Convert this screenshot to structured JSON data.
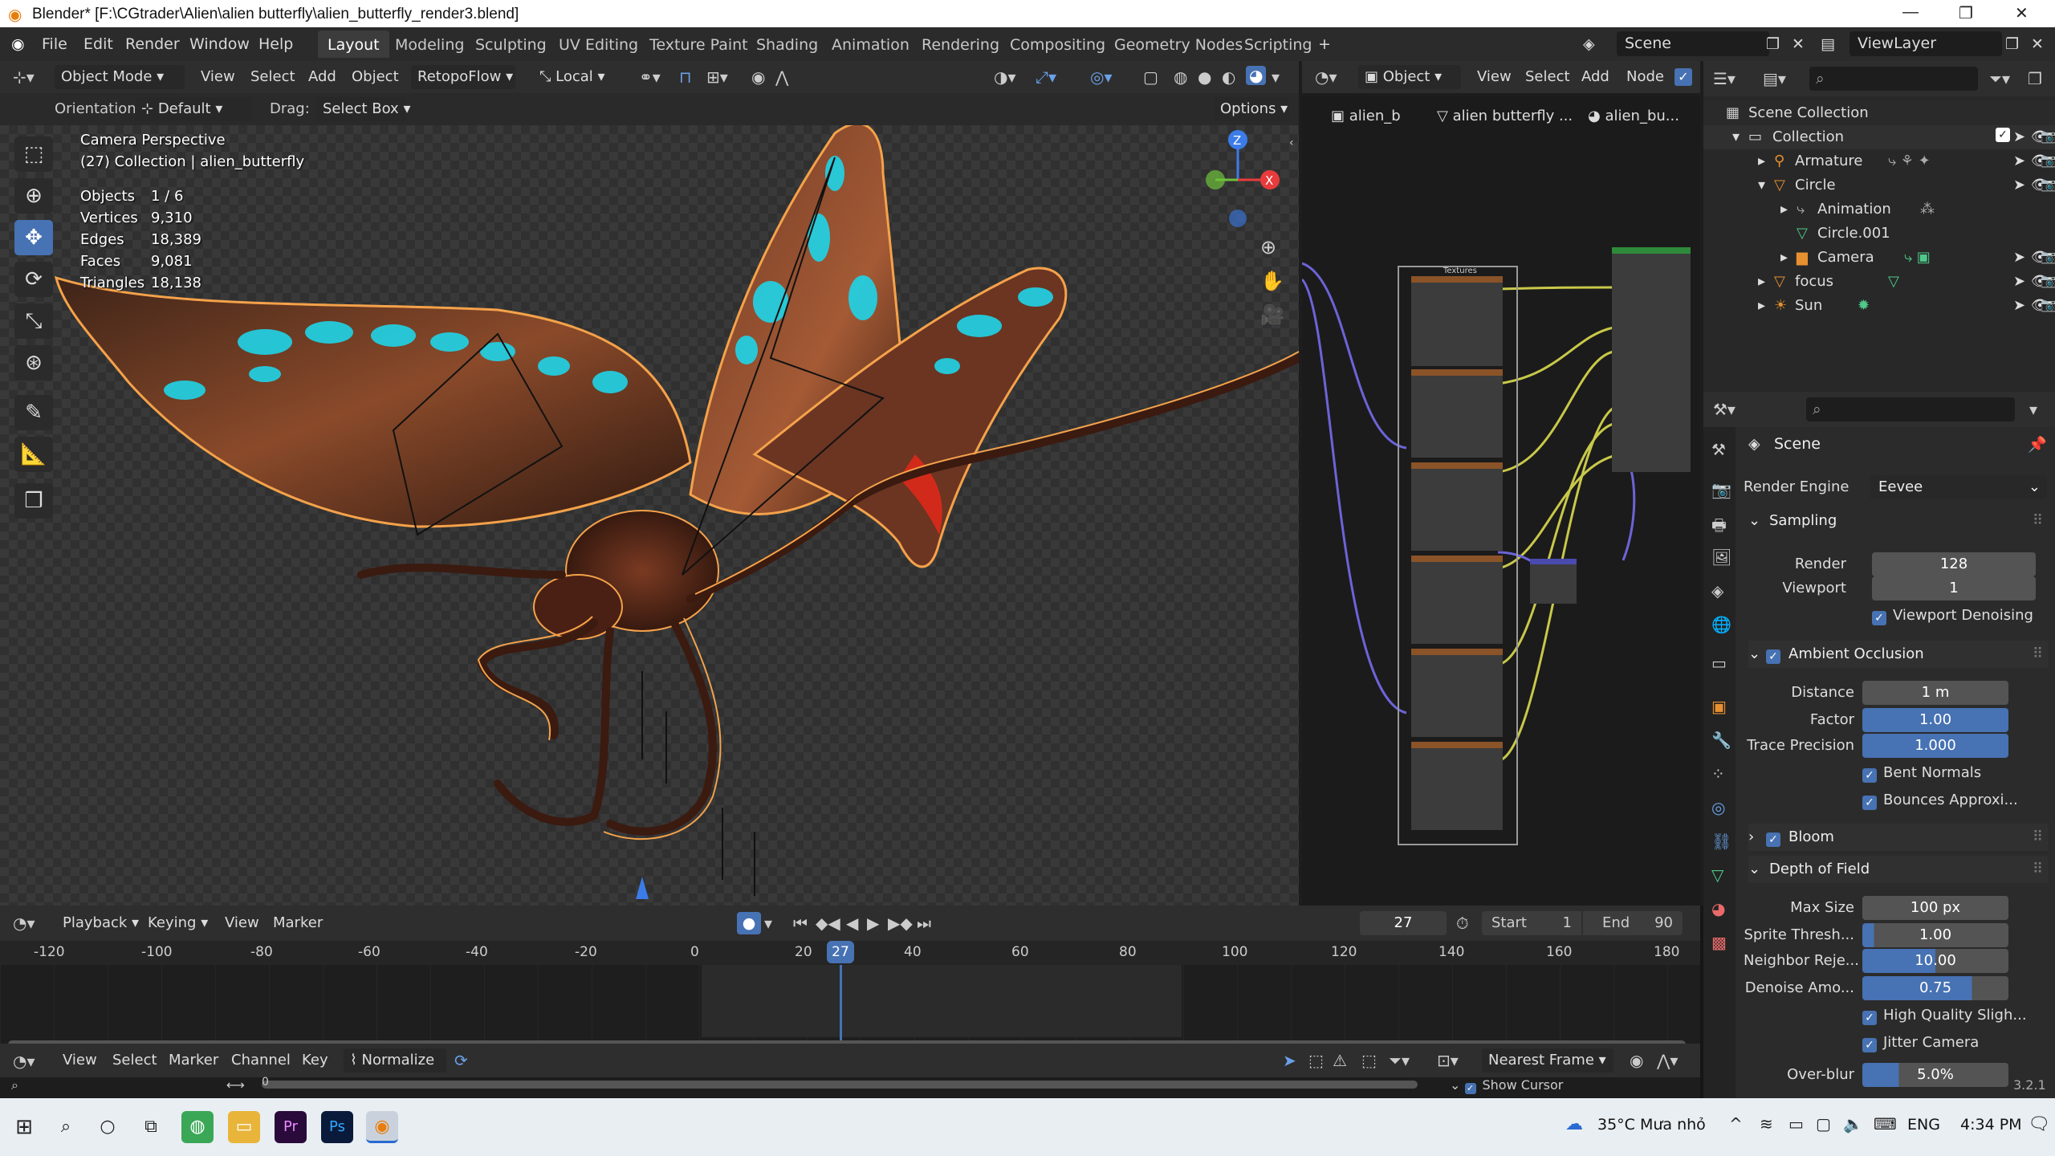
{
  "window": {
    "title": "Blender* [F:\\CGtrader\\Alien\\alien butterfly\\alien_butterfly_render3.blend]"
  },
  "menu": {
    "items": [
      "File",
      "Edit",
      "Render",
      "Window",
      "Help"
    ]
  },
  "workspaces": [
    "Layout",
    "Modeling",
    "Sculpting",
    "UV Editing",
    "Texture Paint",
    "Shading",
    "Animation",
    "Rendering",
    "Compositing",
    "Geometry Nodes",
    "Scripting"
  ],
  "scene_field": "Scene",
  "viewlayer_field": "ViewLayer",
  "viewport_header": {
    "mode": "Object Mode",
    "view": "View",
    "select": "Select",
    "add": "Add",
    "object": "Object",
    "addon": "RetopoFlow",
    "transform": "Local",
    "orientation_label": "Orientation:",
    "orientation_value": "Default",
    "drag_label": "Drag:",
    "drag_value": "Select Box",
    "options": "Options"
  },
  "viewport_overlay": {
    "perspective": "Camera Perspective",
    "collection": "(27) Collection | alien_butterfly",
    "stats": [
      {
        "label": "Objects",
        "value": "1 / 6"
      },
      {
        "label": "Vertices",
        "value": "9,310"
      },
      {
        "label": "Edges",
        "value": "18,389"
      },
      {
        "label": "Faces",
        "value": "9,081"
      },
      {
        "label": "Triangles",
        "value": "18,138"
      }
    ],
    "gizmo": {
      "z": "Z",
      "x": "X"
    }
  },
  "node_header": {
    "object": "Object",
    "view": "View",
    "select": "Select",
    "add": "Add",
    "node": "Node",
    "breadcrumbs": [
      "alien_b",
      "alien butterfly ...",
      "alien_bu..."
    ],
    "frame_label": "Textures"
  },
  "outliner": {
    "rows": [
      {
        "label": "Scene Collection",
        "indent": 0,
        "icon": "scene-collection-icon"
      },
      {
        "label": "Collection",
        "indent": 1,
        "icon": "collection-icon"
      },
      {
        "label": "Armature",
        "indent": 2,
        "icon": "armature-icon"
      },
      {
        "label": "Circle",
        "indent": 2,
        "icon": "object-icon"
      },
      {
        "label": "Animation",
        "indent": 3,
        "icon": "animation-icon"
      },
      {
        "label": "Circle.001",
        "indent": 3,
        "icon": "mesh-icon"
      },
      {
        "label": "Camera",
        "indent": 3,
        "icon": "camera-icon"
      },
      {
        "label": "focus",
        "indent": 2,
        "icon": "empty-icon"
      },
      {
        "label": "Sun",
        "indent": 2,
        "icon": "light-icon"
      }
    ]
  },
  "properties": {
    "context": "Scene",
    "render_engine_label": "Render Engine",
    "render_engine_value": "Eevee",
    "sampling": {
      "title": "Sampling",
      "render_label": "Render",
      "render_value": "128",
      "viewport_label": "Viewport",
      "viewport_value": "1",
      "denoise": "Viewport Denoising"
    },
    "ao": {
      "title": "Ambient Occlusion",
      "distance_label": "Distance",
      "distance_value": "1 m",
      "factor_label": "Factor",
      "factor_value": "1.00",
      "trace_label": "Trace Precision",
      "trace_value": "1.000",
      "bent": "Bent Normals",
      "bounces": "Bounces Approxi..."
    },
    "bloom": {
      "title": "Bloom"
    },
    "dof": {
      "title": "Depth of Field",
      "maxsize_label": "Max Size",
      "maxsize_value": "100 px",
      "sprite_label": "Sprite Thresh...",
      "sprite_value": "1.00",
      "neighbor_label": "Neighbor Reje...",
      "neighbor_value": "10.00",
      "denoise_label": "Denoise Amo...",
      "denoise_value": "0.75",
      "denoise_fraction": 0.75,
      "hq": "High Quality Sligh...",
      "jitter": "Jitter Camera",
      "overblur_label": "Over-blur",
      "overblur_value": "5.0%"
    }
  },
  "timeline": {
    "playback": "Playback",
    "keying": "Keying",
    "view": "View",
    "marker": "Marker",
    "current_frame": "27",
    "start_label": "Start",
    "start_value": "1",
    "end_label": "End",
    "end_value": "90",
    "ticks": [
      "-120",
      "-100",
      "-80",
      "-60",
      "-40",
      "-20",
      "0",
      "20",
      "40",
      "60",
      "80",
      "100",
      "120",
      "140",
      "160",
      "180"
    ],
    "dope_view": "View",
    "dope_select": "Select",
    "dope_marker": "Marker",
    "dope_channel": "Channel",
    "dope_key": "Key",
    "normalize": "Normalize",
    "snap": "Nearest Frame",
    "dope_zero": "0",
    "show_cursor": "Show Cursor"
  },
  "version": "3.2.1",
  "taskbar": {
    "weather": "35°C  Mưa nhỏ",
    "lang": "ENG",
    "time": "4:34 PM"
  },
  "colors": {
    "accent": "#4772b3",
    "orange": "#e7902f",
    "active_obj": "#f5a24a"
  }
}
